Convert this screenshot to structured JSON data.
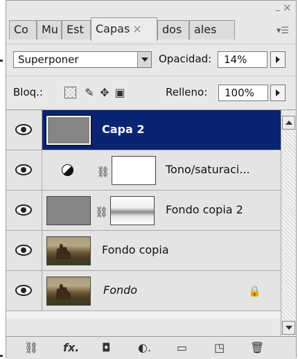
{
  "window": {
    "minimize_icon": "minimize-icon",
    "close_icon": "close-icon"
  },
  "tabs": [
    {
      "label": "Co"
    },
    {
      "label": "Mu"
    },
    {
      "label": "Est"
    },
    {
      "label": "Capas",
      "active": true,
      "close": "×"
    },
    {
      "label": "dos"
    },
    {
      "label": "ales"
    }
  ],
  "blend": {
    "mode": "Superponer",
    "opacity_label": "Opacidad:",
    "opacity_value": "14%"
  },
  "lock": {
    "label": "Bloq.:",
    "fill_label": "Relleno:",
    "fill_value": "100%"
  },
  "layers": [
    {
      "name": "Capa 2",
      "selected": true,
      "thumb": "gray"
    },
    {
      "name": "Tono/saturaci...",
      "adjustment": true,
      "thumb": "white"
    },
    {
      "name": "Fondo copia 2",
      "thumb": "gray",
      "mask": true
    },
    {
      "name": "Fondo copia",
      "thumb": "photo"
    },
    {
      "name": "Fondo",
      "thumb": "photo",
      "italic": true,
      "locked": true
    }
  ],
  "footer_icons": [
    "link-icon",
    "fx-icon",
    "mask-icon",
    "adjustment-icon",
    "folder-icon",
    "new-layer-icon",
    "trash-icon"
  ],
  "colors": {
    "selected_row": "#0a2472",
    "panel_bg": "#e8e8e8"
  }
}
